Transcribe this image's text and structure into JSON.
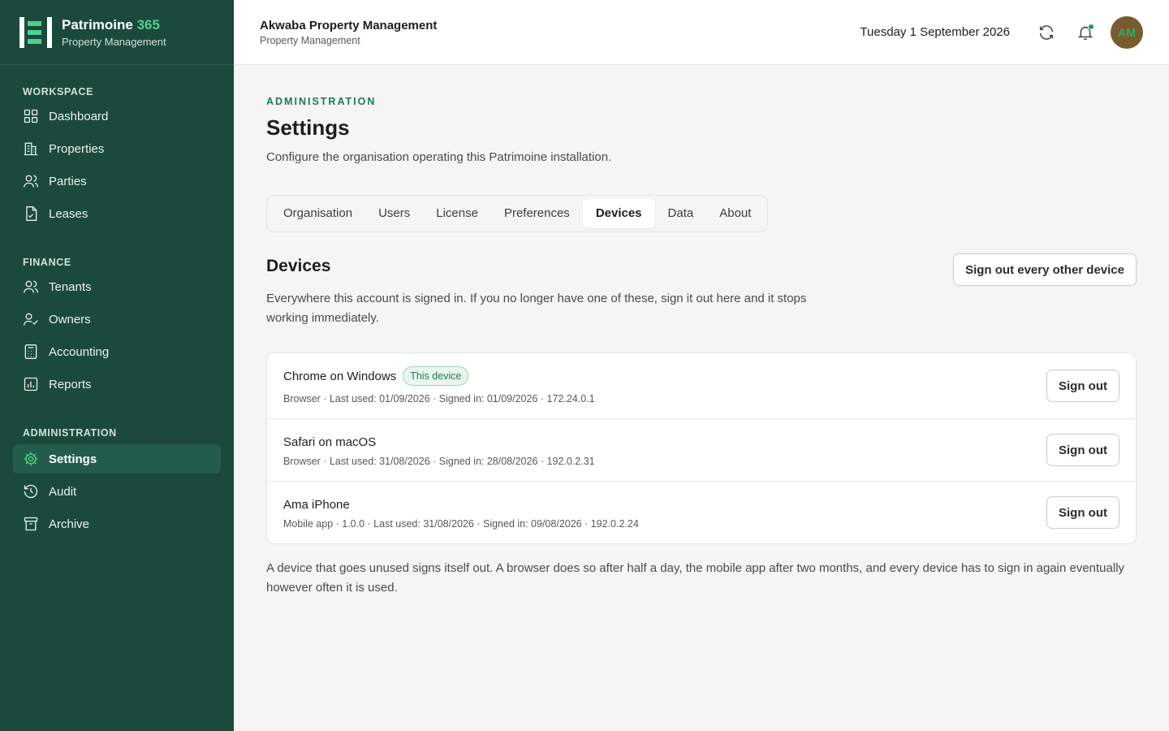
{
  "brand": {
    "name_main": "Patrimoine",
    "name_accent": "365",
    "subtitle": "Property Management"
  },
  "sidebar": {
    "sections": [
      {
        "heading": "WORKSPACE",
        "items": [
          {
            "label": "Dashboard",
            "icon": "dashboard-icon"
          },
          {
            "label": "Properties",
            "icon": "building-icon"
          },
          {
            "label": "Parties",
            "icon": "users-icon"
          },
          {
            "label": "Leases",
            "icon": "document-icon"
          }
        ]
      },
      {
        "heading": "FINANCE",
        "items": [
          {
            "label": "Tenants",
            "icon": "users-icon"
          },
          {
            "label": "Owners",
            "icon": "user-check-icon"
          },
          {
            "label": "Accounting",
            "icon": "calculator-icon"
          },
          {
            "label": "Reports",
            "icon": "chart-icon"
          }
        ]
      },
      {
        "heading": "ADMINISTRATION",
        "items": [
          {
            "label": "Settings",
            "icon": "gear-icon",
            "active": true
          },
          {
            "label": "Audit",
            "icon": "history-icon"
          },
          {
            "label": "Archive",
            "icon": "archive-icon"
          }
        ]
      }
    ]
  },
  "header": {
    "org_name": "Akwaba Property Management",
    "org_subtitle": "Property Management",
    "date": "Tuesday 1 September 2026",
    "avatar_initials": "AM",
    "accent_color": "#1e9e5f"
  },
  "page": {
    "eyebrow": "ADMINISTRATION",
    "title": "Settings",
    "description": "Configure the organisation operating this Patrimoine installation.",
    "tabs": [
      "Organisation",
      "Users",
      "License",
      "Preferences",
      "Devices",
      "Data",
      "About"
    ],
    "active_tab": "Devices"
  },
  "devices": {
    "title": "Devices",
    "description": "Everywhere this account is signed in. If you no longer have one of these, sign it out here and it stops working immediately.",
    "sign_out_all_label": "Sign out every other device",
    "items": [
      {
        "name": "Chrome on Windows",
        "badge": "This device",
        "meta": "Browser · Last used: 01/09/2026 · Signed in: 01/09/2026 · 172.24.0.1",
        "action": "Sign out"
      },
      {
        "name": "Safari on macOS",
        "badge": "",
        "meta": "Browser · Last used: 31/08/2026 · Signed in: 28/08/2026 · 192.0.2.31",
        "action": "Sign out"
      },
      {
        "name": "Ama iPhone",
        "badge": "",
        "meta": "Mobile app · 1.0.0 · Last used: 31/08/2026 · Signed in: 09/08/2026 · 192.0.2.24",
        "action": "Sign out"
      }
    ],
    "footnote": "A device that goes unused signs itself out. A browser does so after half a day, the mobile app after two months, and every device has to sign in again eventually however often it is used."
  }
}
